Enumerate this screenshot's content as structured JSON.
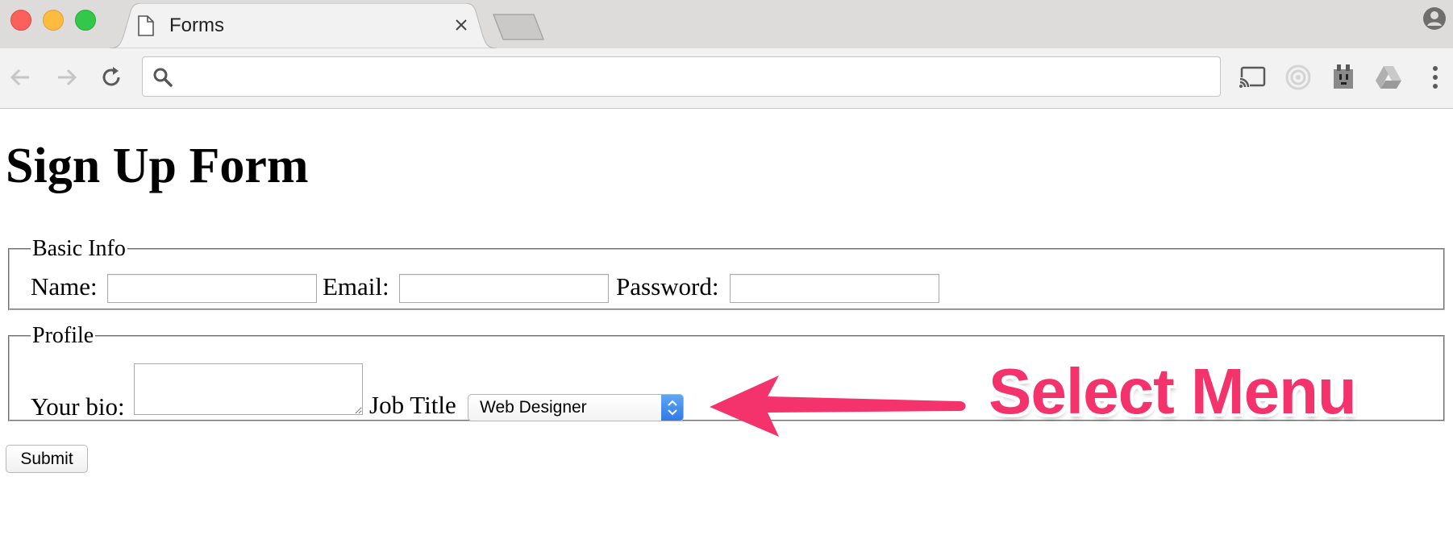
{
  "browser": {
    "tab_title": "Forms",
    "address_value": "",
    "accent_colors": {
      "close_red": "#fc605c",
      "minimize_yellow": "#fdbc40",
      "zoom_green": "#34c84a"
    }
  },
  "page": {
    "heading": "Sign Up Form",
    "basic_info": {
      "legend": "Basic Info",
      "name_label": "Name:",
      "email_label": "Email:",
      "password_label": "Password:"
    },
    "profile": {
      "legend": "Profile",
      "bio_label": "Your bio:",
      "job_title_label": "Job Title",
      "job_title_selected": "Web Designer"
    },
    "submit_label": "Submit"
  },
  "annotation": {
    "label": "Select Menu",
    "color": "#f4336d"
  }
}
